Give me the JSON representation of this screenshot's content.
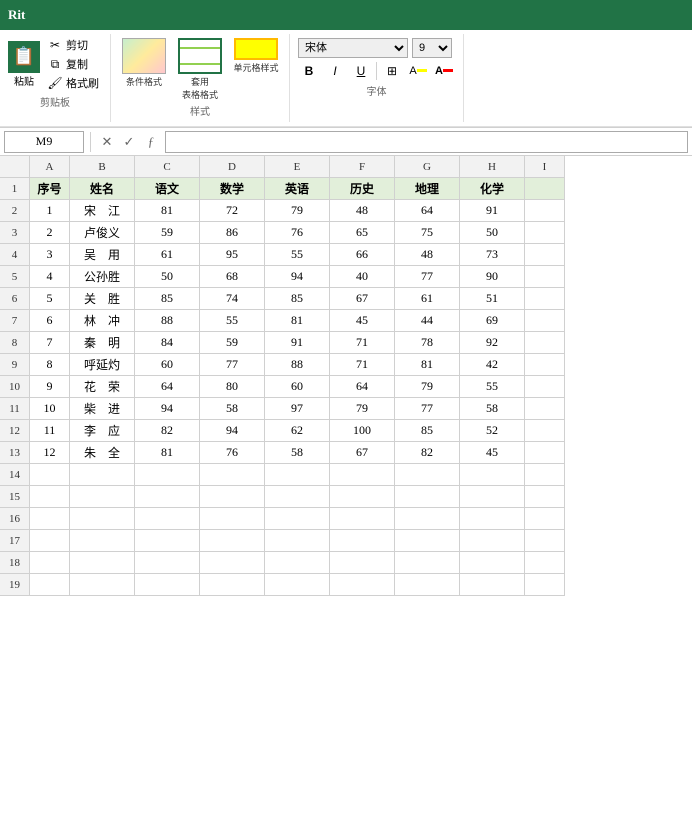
{
  "app": {
    "title": "Rit",
    "green": "#217346"
  },
  "ribbon": {
    "paste_label": "粘贴",
    "cut_label": "剪切",
    "copy_label": "复制",
    "format_painter_label": "格式刷",
    "clipboard_label": "剪贴板",
    "cond_format_label": "条件格式",
    "table_format_label": "套用\n表格格式",
    "cell_style_label": "单元格样式",
    "styles_label": "样式",
    "font_name": "宋体",
    "font_size": "9",
    "bold_label": "B",
    "italic_label": "I",
    "underline_label": "U",
    "font_group_label": "字体"
  },
  "formula_bar": {
    "cell_ref": "M9",
    "formula_content": ""
  },
  "columns": [
    "A",
    "B",
    "C",
    "D",
    "E",
    "F",
    "G",
    "H",
    "I"
  ],
  "col_headers": [
    {
      "label": "A",
      "cls": "col-a"
    },
    {
      "label": "B",
      "cls": "col-b"
    },
    {
      "label": "C",
      "cls": "col-c"
    },
    {
      "label": "D",
      "cls": "col-d"
    },
    {
      "label": "E",
      "cls": "col-e"
    },
    {
      "label": "F",
      "cls": "col-f"
    },
    {
      "label": "G",
      "cls": "col-g"
    },
    {
      "label": "H",
      "cls": "col-h"
    },
    {
      "label": "I",
      "cls": "col-i"
    }
  ],
  "rows": [
    {
      "row_num": "1",
      "cells": [
        "序号",
        "姓名",
        "语文",
        "数学",
        "英语",
        "历史",
        "地理",
        "化学",
        ""
      ],
      "is_header": true
    },
    {
      "row_num": "2",
      "cells": [
        "1",
        "宋　江",
        "81",
        "72",
        "79",
        "48",
        "64",
        "91",
        ""
      ],
      "is_header": false
    },
    {
      "row_num": "3",
      "cells": [
        "2",
        "卢俊义",
        "59",
        "86",
        "76",
        "65",
        "75",
        "50",
        ""
      ],
      "is_header": false
    },
    {
      "row_num": "4",
      "cells": [
        "3",
        "吴　用",
        "61",
        "95",
        "55",
        "66",
        "48",
        "73",
        ""
      ],
      "is_header": false
    },
    {
      "row_num": "5",
      "cells": [
        "4",
        "公孙胜",
        "50",
        "68",
        "94",
        "40",
        "77",
        "90",
        ""
      ],
      "is_header": false
    },
    {
      "row_num": "6",
      "cells": [
        "5",
        "关　胜",
        "85",
        "74",
        "85",
        "67",
        "61",
        "51",
        ""
      ],
      "is_header": false
    },
    {
      "row_num": "7",
      "cells": [
        "6",
        "林　冲",
        "88",
        "55",
        "81",
        "45",
        "44",
        "69",
        ""
      ],
      "is_header": false
    },
    {
      "row_num": "8",
      "cells": [
        "7",
        "秦　明",
        "84",
        "59",
        "91",
        "71",
        "78",
        "92",
        ""
      ],
      "is_header": false
    },
    {
      "row_num": "9",
      "cells": [
        "8",
        "呼延灼",
        "60",
        "77",
        "88",
        "71",
        "81",
        "42",
        ""
      ],
      "is_header": false,
      "is_selected": true
    },
    {
      "row_num": "10",
      "cells": [
        "9",
        "花　荣",
        "64",
        "80",
        "60",
        "64",
        "79",
        "55",
        ""
      ],
      "is_header": false
    },
    {
      "row_num": "11",
      "cells": [
        "10",
        "柴　进",
        "94",
        "58",
        "97",
        "79",
        "77",
        "58",
        ""
      ],
      "is_header": false
    },
    {
      "row_num": "12",
      "cells": [
        "11",
        "李　应",
        "82",
        "94",
        "62",
        "100",
        "85",
        "52",
        ""
      ],
      "is_header": false
    },
    {
      "row_num": "13",
      "cells": [
        "12",
        "朱　全",
        "81",
        "76",
        "58",
        "67",
        "82",
        "45",
        ""
      ],
      "is_header": false
    },
    {
      "row_num": "14",
      "cells": [
        "",
        "",
        "",
        "",
        "",
        "",
        "",
        "",
        ""
      ],
      "is_header": false
    },
    {
      "row_num": "15",
      "cells": [
        "",
        "",
        "",
        "",
        "",
        "",
        "",
        "",
        ""
      ],
      "is_header": false
    },
    {
      "row_num": "16",
      "cells": [
        "",
        "",
        "",
        "",
        "",
        "",
        "",
        "",
        ""
      ],
      "is_header": false
    },
    {
      "row_num": "17",
      "cells": [
        "",
        "",
        "",
        "",
        "",
        "",
        "",
        "",
        ""
      ],
      "is_header": false
    },
    {
      "row_num": "18",
      "cells": [
        "",
        "",
        "",
        "",
        "",
        "",
        "",
        "",
        ""
      ],
      "is_header": false
    },
    {
      "row_num": "19",
      "cells": [
        "",
        "",
        "",
        "",
        "",
        "",
        "",
        "",
        ""
      ],
      "is_header": false
    }
  ]
}
